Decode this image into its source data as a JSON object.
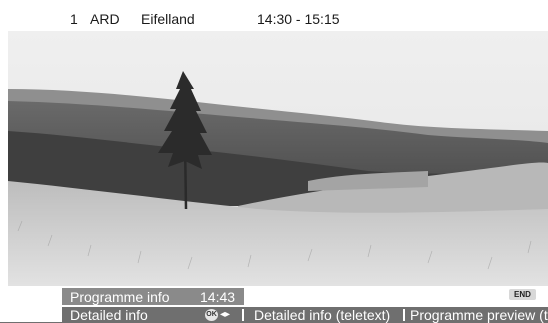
{
  "header": {
    "programme_number": "1",
    "channel": "ARD",
    "title": "Eifelland",
    "time_range": "14:30 - 15:15"
  },
  "info_bar": {
    "label": "Programme info",
    "time": "14:43",
    "end_key": "END"
  },
  "option_bar": {
    "item1": "Detailed info",
    "ok_key": "OK",
    "arrows": "◂▸",
    "item2": "Detailed info (teletext)",
    "item3": "Programme preview (t"
  },
  "colors": {
    "info_bar_bg": "#8a8a8a",
    "option_bar_bg": "#6f6f6f"
  }
}
